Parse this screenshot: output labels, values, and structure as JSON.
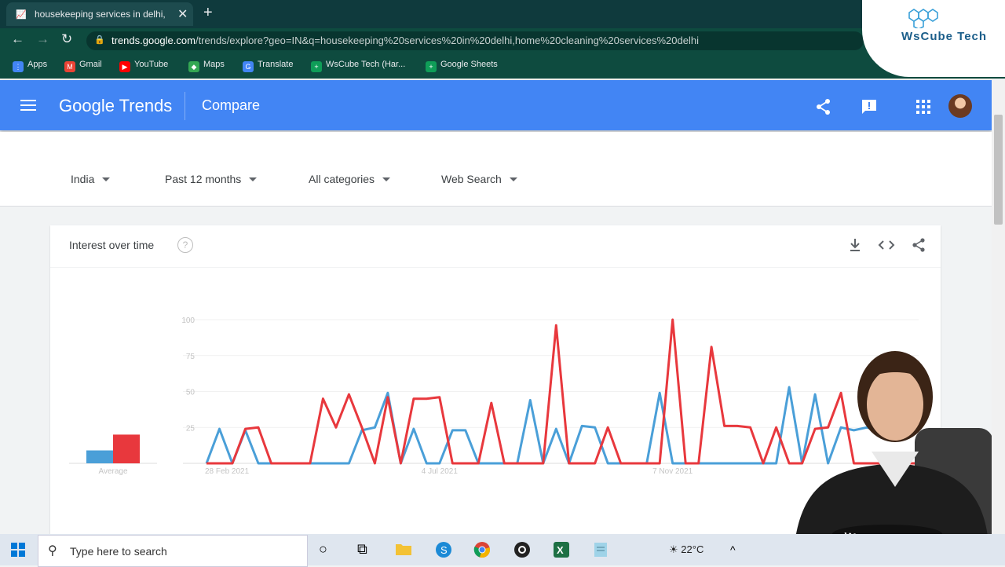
{
  "browser": {
    "tab_title": "housekeeping services in delhi, h",
    "tab_close": "✕",
    "new_tab": "+",
    "url_host": "trends.google.com",
    "url_path": "/trends/explore?geo=IN&q=housekeeping%20services%20in%20delhi,home%20cleaning%20services%20delhi",
    "bookmarks": [
      {
        "label": "Apps",
        "icon": "apps-grid-icon",
        "color": "#ea4335"
      },
      {
        "label": "Gmail",
        "icon": "gmail-icon",
        "color": "#ea4335"
      },
      {
        "label": "YouTube",
        "icon": "youtube-icon",
        "color": "#ff0000"
      },
      {
        "label": "Maps",
        "icon": "maps-icon",
        "color": "#34a853"
      },
      {
        "label": "Translate",
        "icon": "translate-icon",
        "color": "#4285f4"
      },
      {
        "label": "WsCube Tech (Har...",
        "icon": "plus-bookmark-icon",
        "color": "#0f9d58"
      },
      {
        "label": "Google Sheets",
        "icon": "sheets-icon",
        "color": "#0f9d58"
      }
    ]
  },
  "logo": {
    "text": "WsCube Tech"
  },
  "header": {
    "brand": "Google Trends",
    "section": "Compare"
  },
  "filters": {
    "region": "India",
    "period": "Past 12 months",
    "category": "All categories",
    "search_type": "Web Search"
  },
  "card": {
    "title": "Interest over time",
    "help": "?"
  },
  "chart_data": {
    "type": "line",
    "title": "Interest over time",
    "ylim": [
      0,
      100
    ],
    "y_ticks": [
      100,
      75,
      50,
      25
    ],
    "x_tick_labels": [
      "28 Feb 2021",
      "4 Jul 2021",
      "7 Nov 2021"
    ],
    "x_tick_indices": [
      0,
      18,
      36
    ],
    "average_label": "Average",
    "averages": [
      9,
      20
    ],
    "colors": [
      "#4a9fd8",
      "#e8383d"
    ],
    "series": [
      {
        "values": [
          0,
          24,
          0,
          23,
          0,
          0,
          0,
          0,
          0,
          0,
          0,
          0,
          23,
          25,
          49,
          0,
          24,
          0,
          0,
          23,
          23,
          0,
          0,
          0,
          0,
          44,
          0,
          24,
          0,
          26,
          25,
          0,
          0,
          0,
          0,
          49,
          0,
          0,
          0,
          0,
          0,
          0,
          0,
          0,
          0,
          53,
          0,
          48,
          0,
          25,
          23,
          25,
          23,
          24,
          25,
          25
        ]
      },
      {
        "values": [
          0,
          0,
          0,
          24,
          25,
          0,
          0,
          0,
          0,
          45,
          25,
          48,
          25,
          0,
          46,
          0,
          45,
          45,
          46,
          0,
          0,
          0,
          42,
          0,
          0,
          0,
          0,
          96,
          0,
          0,
          0,
          25,
          0,
          0,
          0,
          0,
          100,
          0,
          0,
          81,
          26,
          26,
          25,
          0,
          25,
          0,
          0,
          24,
          25,
          49,
          0,
          0,
          0,
          0,
          0,
          0
        ]
      }
    ]
  },
  "taskbar": {
    "search_placeholder": "Type here to search",
    "temperature": "22°C"
  }
}
